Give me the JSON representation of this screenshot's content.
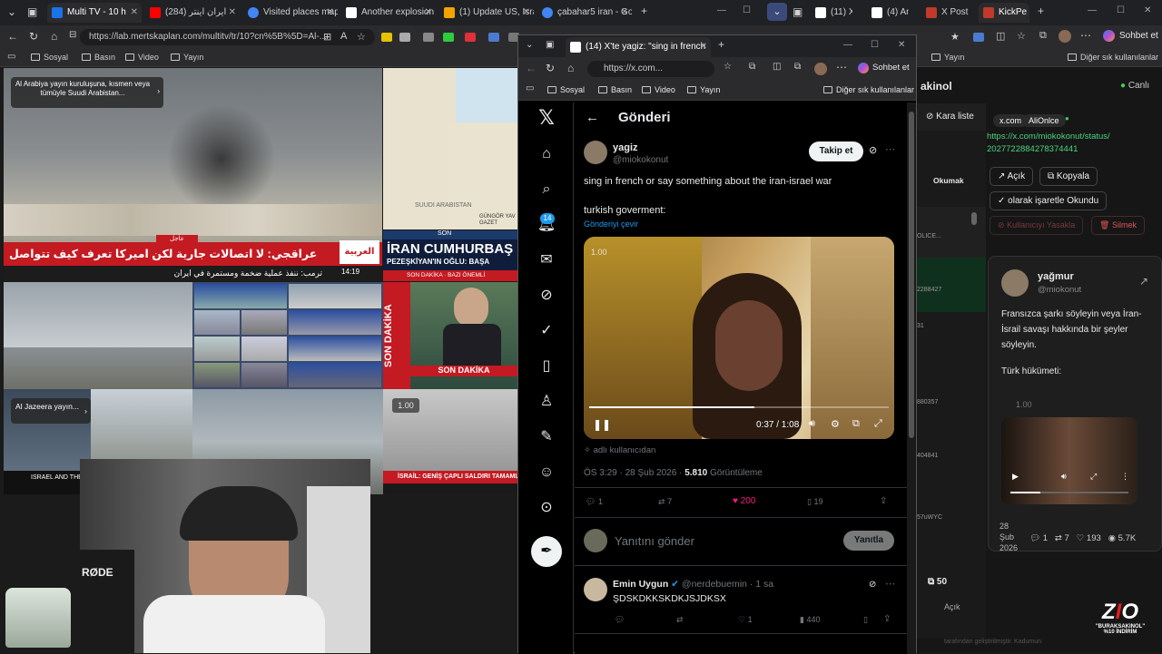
{
  "browser": {
    "tabs": [
      {
        "label": "Multi TV - 10 h",
        "color": "#1a73e8",
        "active": true
      },
      {
        "label": "(284) ایران اینتر",
        "color": "#ff0000"
      },
      {
        "label": "Visited places map",
        "color": "#4285f4"
      },
      {
        "label": "Another explosion",
        "color": "#ffffff"
      },
      {
        "label": "(1) Update US, Israe",
        "color": "#f4a300"
      },
      {
        "label": "çabahar5 iran - Goo",
        "color": "#4285f4"
      },
      {
        "label": "(11) X",
        "color": "#ffffff"
      },
      {
        "label": "(4) An",
        "color": "#ffffff"
      },
      {
        "label": "X Post",
        "color": "#ffffff"
      },
      {
        "label": "KickPe",
        "color": "#53fc18"
      }
    ],
    "url": "https://lab.mertskaplan.com/multitv/tr/10?cn%5B%5D=Al-...",
    "bookmarks": [
      "Sosyal",
      "Basın",
      "Video",
      "Yayın"
    ],
    "right_bookmarks": [
      "Yayın",
      "Diğer sık kullanılanlar"
    ],
    "sohbet": "Sohbet et"
  },
  "videos": {
    "toast1": "Al Arabiya yayın kuruluşuna, kısmen veya tümüyle Suudi Arabistan...",
    "arabiya_ticker": "عراقجي: لا اتصالات جارية لكن اميركا تعرف كيف تتواصل معنا إذا ارادت",
    "arabiya_sub": "ترمب: ننفذ عملية ضخمة ومستمرة في ايران",
    "arabiya_tag": "عاجل",
    "arabiya_logo": "العربية",
    "arabiya_time": "14:19",
    "map_label": "SUUDI ARABISTAN",
    "gungor": "GÜNGÖR YAV GAZET",
    "son_label": "SON",
    "iran_headline": "İRAN CUMHURBAŞ",
    "iran_sub": "PEZEŞKİYAN'IN OĞLU: BAŞA",
    "son_dakika": "SON DAKİKA",
    "son_dakika_side": "SON DAKİKA",
    "bazi": "BAZI ÖNEMLİ",
    "toast2": "Al Jazeera yayın...",
    "speed": "1.00",
    "israil": "İSRAİL: GENİŞ ÇAPLI SALDIRI TAMAMLA",
    "rode": "RØDE",
    "aljazeera_bottom": "ISRAEL AND THE US ON IRAN PROMPTING"
  },
  "xwin": {
    "tab_title": "(14) X'te yagiz: \"sing in french",
    "url": "https://x.com...",
    "bookmarks": [
      "Sosyal",
      "Basın",
      "Video",
      "Yayın"
    ],
    "other_bm": "Diğer sık kullanılanlar",
    "sohbet": "Sohbet et",
    "header": "Gönderi",
    "badge": "14",
    "post": {
      "name": "yagiz",
      "handle": "@miokokonut",
      "follow": "Takip et",
      "text1": "sing in french or say something about the iran-israel war",
      "text2": "turkish goverment:",
      "translate": "Gönderiyi çevir",
      "video_time": "0:37 / 1:08",
      "video_corner": "1.00",
      "from_user": "adlı kullanıcıdan",
      "meta": "ÖS 3:29 · 28 Şub 2026 · ",
      "views": "5.810",
      "views_label": "Görüntüleme",
      "replies": "1",
      "reposts": "7",
      "likes": "200",
      "bookmarks": "19"
    },
    "reply_placeholder": "Yanıtını gönder",
    "reply_button": "Yanıtla",
    "comment": {
      "name": "Emin Uygun",
      "handle": "@nerdebuemin · 1 sa",
      "text": "ŞDSKDKKSKDKJSJDKSX",
      "likes": "1",
      "views": "440"
    }
  },
  "right_panel": {
    "title": "akinol",
    "status": "Canlı",
    "kara_liste": "Kara liste",
    "chips": [
      "x.com",
      "AliOnlce"
    ],
    "link": "https://x.com/miokokonut/status/2027722884278374441",
    "ac": "Açık",
    "kopyala": "Kopyala",
    "okundu": "olarak işaretle Okundu",
    "yasakla": "Kullanıcıyı Yasakla",
    "sil": "Silmek",
    "okumak": "Okumak",
    "rows": [
      "OLICE...",
      "2288427",
      "31",
      "880357",
      "404841",
      "57uWYC",
      "50",
      "Açık"
    ],
    "card": {
      "name": "yağmur",
      "handle": "@miokonut",
      "text1": "Fransızca şarkı söyleyin veya İran-İsrail savaşı hakkında bir şeyler söyleyin.",
      "text2": "Türk hükümeti:",
      "speed": "1.00",
      "date": "28 Şub 2026",
      "replies": "1",
      "reposts": "7",
      "likes": "193",
      "views": "5.7K"
    },
    "zio_line1": "\"BURAKSAKINOL\"",
    "zio_line2": "%10 İNDİRİM",
    "footer": "tarafından geliştirilmiştir. Kadumun"
  }
}
